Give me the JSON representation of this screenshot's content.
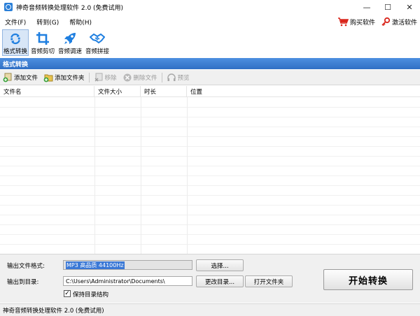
{
  "window": {
    "title": "神奇音频转换处理软件 2.0 (免费试用)",
    "min_glyph": "—",
    "max_glyph": "☐",
    "close_glyph": "✕"
  },
  "menu": {
    "items": [
      "文件(F)",
      "转到(G)",
      "帮助(H)"
    ]
  },
  "right_actions": {
    "buy": "购买软件",
    "activate": "激活软件"
  },
  "toolbar": {
    "tools": [
      {
        "label": "格式转换",
        "icon": "format-convert-icon",
        "active": true
      },
      {
        "label": "音频剪切",
        "icon": "crop-icon",
        "active": false
      },
      {
        "label": "音频调速",
        "icon": "rocket-icon",
        "active": false
      },
      {
        "label": "音频拼接",
        "icon": "handshake-icon",
        "active": false
      }
    ]
  },
  "section": {
    "title": "格式转换"
  },
  "actions": {
    "add_file": "添加文件",
    "add_folder": "添加文件夹",
    "remove": "移除",
    "delete_file": "删除文件",
    "preview": "预览"
  },
  "table": {
    "columns": [
      "文件名",
      "文件大小",
      "时长",
      "位置"
    ],
    "rows": []
  },
  "output": {
    "format_label": "输出文件格式:",
    "format_value": "MP3 高品质 44100Hz",
    "choose_button": "选择...",
    "dir_label": "输出到目录:",
    "dir_value": "C:\\Users\\Administrator\\Documents\\",
    "change_dir_button": "更改目录...",
    "open_folder_button": "打开文件夹",
    "keep_structure_label": "保持目录结构",
    "keep_structure_checked": true,
    "start_button": "开始转换"
  },
  "status": {
    "text": "神奇音频转换处理软件 2.0 (免费试用)"
  },
  "colors": {
    "accent": "#2f6fc4",
    "icon_blue": "#1f7fe0",
    "buy_red": "#d9261c"
  }
}
